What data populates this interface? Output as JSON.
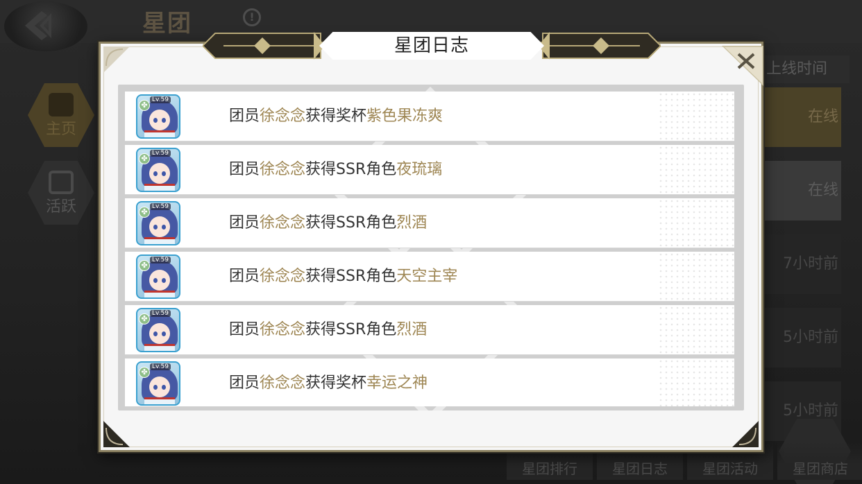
{
  "background": {
    "title": "星团",
    "info_icon": "!",
    "side_nav": [
      {
        "label": "主页",
        "icon": "home-icon"
      },
      {
        "label": "活跃",
        "icon": "activity-icon"
      }
    ],
    "right_column": {
      "header": "上线时间",
      "values": [
        "在线",
        "在线",
        "7小时前",
        "5小时前",
        "5小时前"
      ]
    },
    "bottom_tabs": [
      "星团排行",
      "星团日志",
      "星团活动",
      "星团商店"
    ]
  },
  "modal": {
    "title": "星团日志",
    "close_icon": "close-icon",
    "log_entries": [
      {
        "prefix": "团员",
        "member": "徐念念",
        "action": "获得奖杯",
        "item": "紫色果冻爽",
        "level": "Lv.59"
      },
      {
        "prefix": "团员",
        "member": "徐念念",
        "action": "获得SSR角色",
        "item": "夜琉璃",
        "level": "Lv.59"
      },
      {
        "prefix": "团员",
        "member": "徐念念",
        "action": "获得SSR角色",
        "item": "烈酒",
        "level": "Lv.59"
      },
      {
        "prefix": "团员",
        "member": "徐念念",
        "action": "获得SSR角色",
        "item": "天空主宰",
        "level": "Lv.59"
      },
      {
        "prefix": "团员",
        "member": "徐念念",
        "action": "获得SSR角色",
        "item": "烈酒",
        "level": "Lv.59"
      },
      {
        "prefix": "团员",
        "member": "徐念念",
        "action": "获得奖杯",
        "item": "幸运之神",
        "level": "Lv.59"
      }
    ]
  },
  "colors": {
    "highlight_gold": "#9e8653",
    "frame_gold": "#8a8060",
    "text_dark": "#333333"
  }
}
